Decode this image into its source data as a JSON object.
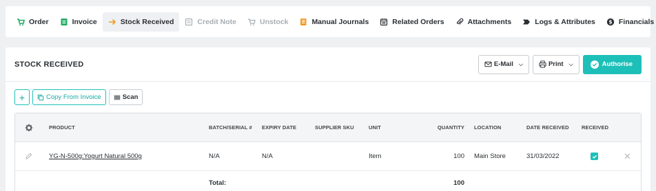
{
  "tabs": [
    {
      "label": "Order",
      "icon": "cart-icon",
      "color": "#1aa85c",
      "state": "normal"
    },
    {
      "label": "Invoice",
      "icon": "invoice-icon",
      "color": "#1aa85c",
      "state": "normal"
    },
    {
      "label": "Stock Received",
      "icon": "arrow-right-icon",
      "color": "#f39a1e",
      "state": "active"
    },
    {
      "label": "Credit Note",
      "icon": "credit-note-icon",
      "color": "#a8adb2",
      "state": "disabled"
    },
    {
      "label": "Unstock",
      "icon": "unstock-cart-icon",
      "color": "#a8adb2",
      "state": "disabled"
    },
    {
      "label": "Manual Journals",
      "icon": "journal-icon",
      "color": "#f39a1e",
      "state": "normal"
    },
    {
      "label": "Related Orders",
      "icon": "calendar-icon",
      "color": "#2b2f33",
      "state": "normal"
    },
    {
      "label": "Attachments",
      "icon": "paperclip-icon",
      "color": "#2b2f33",
      "state": "normal"
    },
    {
      "label": "Logs & Attributes",
      "icon": "tag-icon",
      "color": "#2b2f33",
      "state": "normal"
    },
    {
      "label": "Financials",
      "icon": "dollar-icon",
      "color": "#2b2f33",
      "state": "normal"
    }
  ],
  "panel": {
    "title": "STOCK RECEIVED",
    "email_label": "E-Mail",
    "print_label": "Print",
    "authorise_label": "Authorise"
  },
  "toolbar": {
    "add_label": "+",
    "copy_label": "Copy From Invoice",
    "scan_label": "Scan"
  },
  "table": {
    "headers": {
      "product": "PRODUCT",
      "batch": "BATCH/SERIAL #",
      "expiry": "EXPIRY DATE",
      "supplier_sku": "SUPPLIER SKU",
      "unit": "UNIT",
      "quantity": "QUANTITY",
      "location": "LOCATION",
      "date_received": "DATE RECEIVED",
      "received": "RECEIVED"
    },
    "rows": [
      {
        "product": "YG-N-500g:Yogurt Natural 500g",
        "batch": "N/A",
        "expiry": "N/A",
        "supplier_sku": "",
        "unit": "Item",
        "quantity": "100",
        "location": "Main Store",
        "date_received": "31/03/2022",
        "received": true
      }
    ],
    "total_label": "Total:",
    "total_quantity": "100"
  },
  "colors": {
    "accent": "#1dc0b8",
    "green": "#1aa85c",
    "orange": "#f39a1e"
  }
}
